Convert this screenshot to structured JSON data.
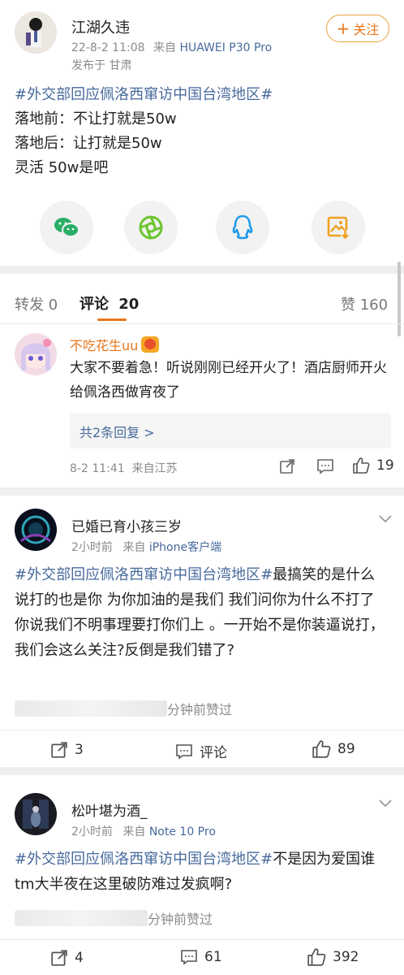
{
  "post": {
    "author": "江湖久违",
    "time": "22-8-2 11:08",
    "from_label": "来自",
    "device": "HUAWEI P30 Pro",
    "location": "发布于 甘肃",
    "follow_label": "关注",
    "hashtag": "#外交部回应佩洛西窜访中国台湾地区#",
    "lines": [
      "落地前：不让打就是50w",
      "落地后：让打就是50w",
      "灵活 50w是吧"
    ]
  },
  "share_icons": [
    "wechat-icon",
    "moments-icon",
    "qq-icon",
    "save-image-icon"
  ],
  "tabs": {
    "repost": "转发 0",
    "comment_label": "评论",
    "comment_count": "20",
    "like": "赞 160"
  },
  "comments": [
    {
      "name": "不吃花生uu",
      "text": "大家不要着急！听说刚刚已经开火了！酒店厨师开火给佩洛西做宵夜了",
      "reply_link": "共2条回复 >",
      "meta": "8-2 11:41  来自江苏",
      "likes": "19"
    },
    {
      "name": "已婚已育小孩三岁",
      "time": "2小时前",
      "from_label": "来自",
      "device": "iPhone客户端",
      "hashtag": "#外交部回应佩洛西窜访中国台湾地区#",
      "text_rest": "最搞笑的是什么 说打的也是你 为你加油的是我们 我们问你为什么不打了 你说我们不明事理要打你们上 。一开始不是你装逼说打，我们会这么关注?反倒是我们错了?",
      "liked_by": "分钟前赞过",
      "reposts": "3",
      "comments": "评论",
      "likes": "89"
    },
    {
      "name": "松叶堪为酒_",
      "time": "2小时前",
      "from_label": "来自",
      "device": "Note 10 Pro",
      "hashtag": "#外交部回应佩洛西窜访中国台湾地区#",
      "text_rest": "不是因为爱国谁tm大半夜在这里破防难过发疯啊?",
      "liked_by": "分钟前赞过",
      "reposts": "4",
      "comments": "61",
      "likes": "392"
    }
  ],
  "colors": {
    "link": "#476a9c",
    "accent": "#e8761c",
    "muted": "#8a8a8a"
  }
}
